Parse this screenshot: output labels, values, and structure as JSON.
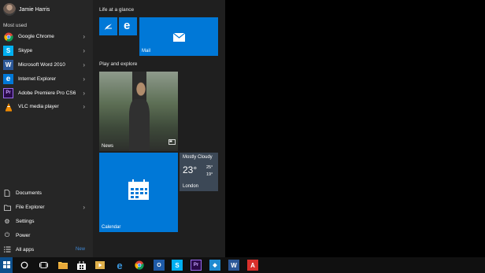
{
  "user": {
    "name": "Jamie Harris"
  },
  "most_used": {
    "label": "Most used",
    "items": [
      {
        "label": "Google Chrome",
        "icon": "chrome-icon",
        "has_arrow": true,
        "color": "#ffffff"
      },
      {
        "label": "Skype",
        "icon": "skype-icon",
        "has_arrow": true,
        "color": "#00aff0"
      },
      {
        "label": "Microsoft Word 2010",
        "icon": "word-icon",
        "has_arrow": true,
        "color": "#2b5797"
      },
      {
        "label": "Internet Explorer",
        "icon": "internet-explorer-icon",
        "has_arrow": true,
        "color": "#0078d7"
      },
      {
        "label": "Adobe Premiere Pro CS6",
        "icon": "premiere-icon",
        "has_arrow": true,
        "color": "#2a0a4a"
      },
      {
        "label": "VLC media player",
        "icon": "vlc-icon",
        "has_arrow": true,
        "color": "#f08a00"
      }
    ]
  },
  "bottom": {
    "items": [
      {
        "label": "Documents",
        "icon": "document-icon",
        "has_arrow": false
      },
      {
        "label": "File Explorer",
        "icon": "folder-icon",
        "has_arrow": true
      },
      {
        "label": "Settings",
        "icon": "gear-icon",
        "has_arrow": false
      },
      {
        "label": "Power",
        "icon": "power-icon",
        "has_arrow": false
      },
      {
        "label": "All apps",
        "icon": "list-icon",
        "badge": "New"
      }
    ]
  },
  "tiles": {
    "group1": {
      "title": "Life at a glance"
    },
    "group2": {
      "title": "Play and explore"
    },
    "mail": {
      "label": "Mail"
    },
    "news": {
      "label": "News"
    },
    "calendar": {
      "label": "Calendar"
    },
    "weather": {
      "desc": "Mostly Cloudy",
      "temp": "23°",
      "high": "25°",
      "low": "19°",
      "location": "London"
    }
  },
  "colors": {
    "accent": "#0078d7",
    "menu_bg": "#1f1f1f",
    "taskbar_bg": "#101010"
  }
}
